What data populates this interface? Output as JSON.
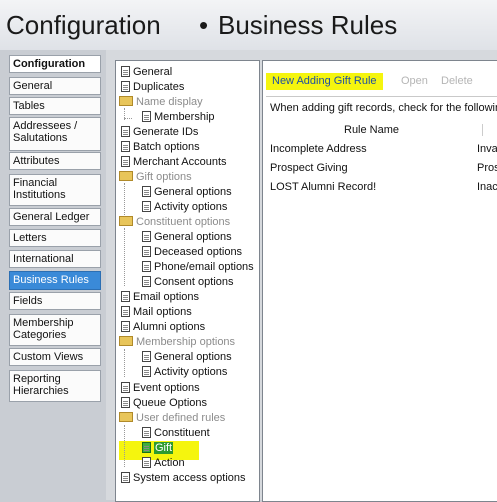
{
  "header": {
    "title": "Configuration",
    "separator": "•",
    "subtitle": "Business Rules"
  },
  "leftnav": {
    "items": [
      {
        "label": "Configuration",
        "name": "nav-configuration"
      },
      {
        "label": "General",
        "name": "nav-general"
      },
      {
        "label": "Tables",
        "name": "nav-tables"
      },
      {
        "label": "Addressees / Salutations",
        "name": "nav-addressees-salutations"
      },
      {
        "label": "Attributes",
        "name": "nav-attributes"
      },
      {
        "label": "Financial Institutions",
        "name": "nav-financial-institutions"
      },
      {
        "label": "General Ledger",
        "name": "nav-general-ledger"
      },
      {
        "label": "Letters",
        "name": "nav-letters"
      },
      {
        "label": "International",
        "name": "nav-international"
      },
      {
        "label": "Business Rules",
        "name": "nav-business-rules"
      },
      {
        "label": "Fields",
        "name": "nav-fields"
      },
      {
        "label": "Membership Categories",
        "name": "nav-membership-categories"
      },
      {
        "label": "Custom Views",
        "name": "nav-custom-views"
      },
      {
        "label": "Reporting Hierarchies",
        "name": "nav-reporting-hierarchies"
      }
    ]
  },
  "tree": {
    "nodes": [
      {
        "label": "General"
      },
      {
        "label": "Duplicates"
      },
      {
        "label": "Name display"
      },
      {
        "label": "Membership"
      },
      {
        "label": "Generate IDs"
      },
      {
        "label": "Batch options"
      },
      {
        "label": "Merchant Accounts"
      },
      {
        "label": "Gift options"
      },
      {
        "label": "General options"
      },
      {
        "label": "Activity options"
      },
      {
        "label": "Constituent options"
      },
      {
        "label": "General options"
      },
      {
        "label": "Deceased options"
      },
      {
        "label": "Phone/email options"
      },
      {
        "label": "Consent options"
      },
      {
        "label": "Email options"
      },
      {
        "label": "Mail options"
      },
      {
        "label": "Alumni options"
      },
      {
        "label": "Membership options"
      },
      {
        "label": "General options"
      },
      {
        "label": "Activity options"
      },
      {
        "label": "Event options"
      },
      {
        "label": "Queue Options"
      },
      {
        "label": "User defined rules"
      },
      {
        "label": "Constituent"
      },
      {
        "label": "Gift"
      },
      {
        "label": "Action"
      },
      {
        "label": "System access options"
      }
    ]
  },
  "toolbar": {
    "new_label": "New Adding Gift Rule",
    "open_label": "Open",
    "delete_label": "Delete"
  },
  "main": {
    "description": "When adding gift records, check for the followin",
    "column_header": "Rule Name",
    "rows": [
      {
        "name": "Incomplete Address",
        "value": "Inva"
      },
      {
        "name": "Prospect Giving",
        "value": "Pros"
      },
      {
        "name": "LOST Alumni Record!",
        "value": "Inac"
      }
    ]
  },
  "colors": {
    "highlight": "#f5f50e",
    "active_nav": "#3a8ad8",
    "link": "#1f4fa3"
  }
}
